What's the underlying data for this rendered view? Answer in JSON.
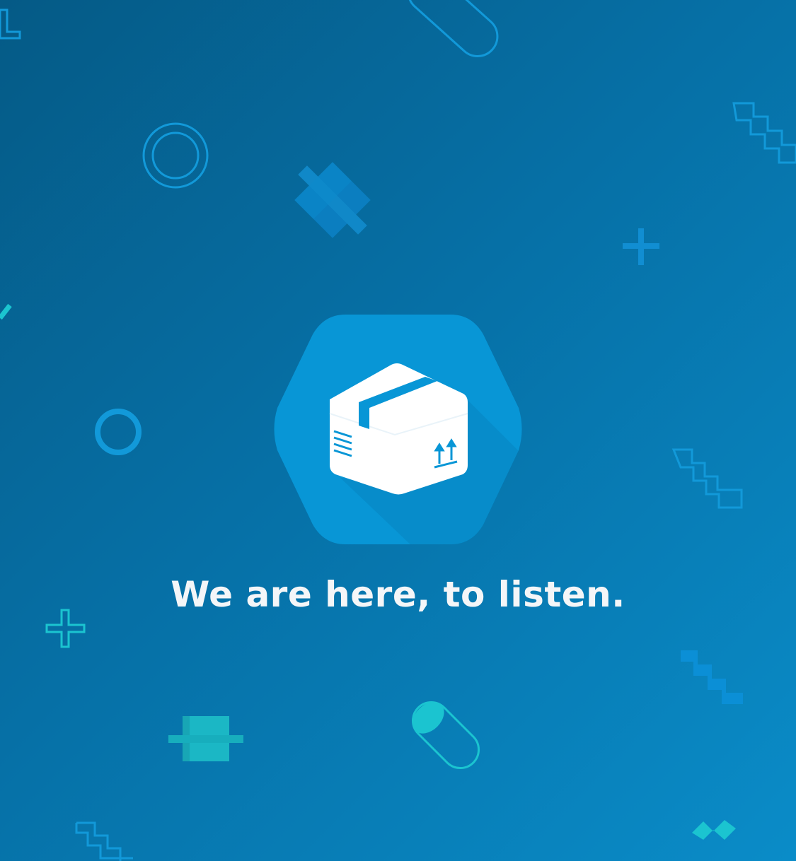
{
  "app": {
    "tagline": "We are here, to listen."
  },
  "colors": {
    "background_dark": "#055a86",
    "background_light": "#0a8cc8",
    "hexagon": "#0896d6",
    "outline_blue": "#1299d9",
    "teal": "#1bc4d0",
    "text": "#f4f6f8"
  },
  "icons": {
    "logo": "package-box-icon",
    "box_marks": "this-side-up-arrows-icon"
  }
}
